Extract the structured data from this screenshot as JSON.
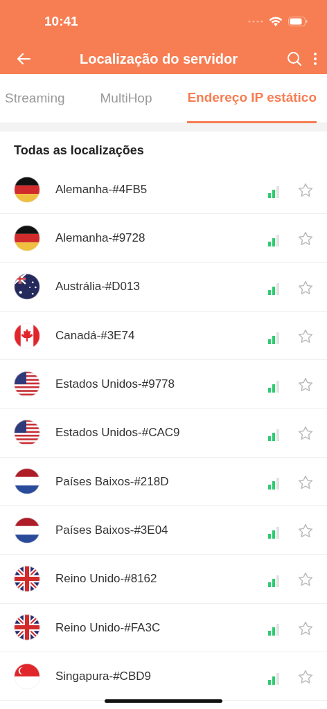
{
  "status_bar": {
    "time": "10:41"
  },
  "app_bar": {
    "title": "Localização do servidor"
  },
  "tabs": [
    {
      "label": "Streaming",
      "selected": false
    },
    {
      "label": "MultiHop",
      "selected": false
    },
    {
      "label": "Endereço IP estático",
      "selected": true
    }
  ],
  "section": {
    "title": "Todas as localizações"
  },
  "servers": [
    {
      "name": "Alemanha-#4FB5",
      "kind": "germany",
      "favorite": false
    },
    {
      "name": "Alemanha-#9728",
      "kind": "germany",
      "favorite": false
    },
    {
      "name": "Austrália-#D013",
      "kind": "australia",
      "favorite": false
    },
    {
      "name": "Canadá-#3E74",
      "kind": "canada",
      "favorite": false
    },
    {
      "name": "Estados Unidos-#9778",
      "kind": "usa",
      "favorite": false
    },
    {
      "name": "Estados Unidos-#CAC9",
      "kind": "usa",
      "favorite": false
    },
    {
      "name": "Países Baixos-#218D",
      "kind": "netherlands",
      "favorite": false
    },
    {
      "name": "Países Baixos-#3E04",
      "kind": "netherlands",
      "favorite": false
    },
    {
      "name": "Reino Unido-#8162",
      "kind": "uk",
      "favorite": false
    },
    {
      "name": "Reino Unido-#FA3C",
      "kind": "uk",
      "favorite": false
    },
    {
      "name": "Singapura-#CBD9",
      "kind": "singapore",
      "favorite": false
    }
  ]
}
